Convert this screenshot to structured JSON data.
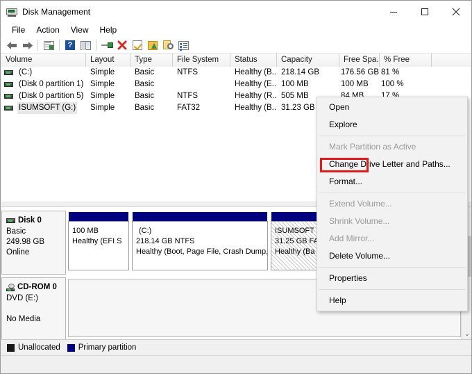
{
  "window": {
    "title": "Disk Management",
    "icon": "disk-management-icon",
    "controls": {
      "minimize": "–",
      "maximize": "□",
      "close": "✕"
    }
  },
  "menubar": {
    "items": [
      "File",
      "Action",
      "View",
      "Help"
    ]
  },
  "toolbar": {
    "buttons": [
      {
        "name": "back-arrow-icon",
        "glyph": "←"
      },
      {
        "name": "forward-arrow-icon",
        "glyph": "→"
      },
      {
        "name": "show-hide-console-tree-icon",
        "glyph": ""
      },
      {
        "name": "help-icon",
        "glyph": "?"
      },
      {
        "name": "action-menu-icon",
        "glyph": ""
      },
      {
        "name": "rescan-disks-icon",
        "glyph": ""
      },
      {
        "name": "delete-icon",
        "glyph": "✖"
      },
      {
        "name": "check-icon",
        "glyph": ""
      },
      {
        "name": "new-volume-icon",
        "glyph": ""
      },
      {
        "name": "properties-search-icon",
        "glyph": ""
      },
      {
        "name": "properties-icon",
        "glyph": ""
      }
    ]
  },
  "volume_list": {
    "columns": [
      "Volume",
      "Layout",
      "Type",
      "File System",
      "Status",
      "Capacity",
      "Free Spa...",
      "% Free",
      ""
    ],
    "rows": [
      {
        "volume": "(C:)",
        "layout": "Simple",
        "type": "Basic",
        "file_system": "NTFS",
        "status": "Healthy (B...",
        "capacity": "218.14 GB",
        "free_space": "176.56 GB",
        "percent_free": "81 %",
        "selected": false
      },
      {
        "volume": "(Disk 0 partition 1)",
        "layout": "Simple",
        "type": "Basic",
        "file_system": "",
        "status": "Healthy (E...",
        "capacity": "100 MB",
        "free_space": "100 MB",
        "percent_free": "100 %",
        "selected": false
      },
      {
        "volume": "(Disk 0 partition 5)",
        "layout": "Simple",
        "type": "Basic",
        "file_system": "NTFS",
        "status": "Healthy (R...",
        "capacity": "505 MB",
        "free_space": "84 MB",
        "percent_free": "17 %",
        "selected": false
      },
      {
        "volume": "ISUMSOFT (G:)",
        "layout": "Simple",
        "type": "Basic",
        "file_system": "FAT32",
        "status": "Healthy (B...",
        "capacity": "31.23 GB",
        "free_space": "",
        "percent_free": "",
        "selected": true
      }
    ]
  },
  "disk_pane": {
    "disks": [
      {
        "name": "Disk 0",
        "type": "Basic",
        "size": "249.98 GB",
        "state": "Online",
        "icon": "disk-icon",
        "partitions": [
          {
            "label": "",
            "size": "100 MB",
            "status": "Healthy (EFI S",
            "selected": false
          },
          {
            "label": "(C:)",
            "size": "218.14 GB NTFS",
            "status": "Healthy (Boot, Page File, Crash Dump, Ba",
            "selected": false
          },
          {
            "label": "ISUMSOFT",
            "size": "31.25 GB FA",
            "status": "Healthy (Ba",
            "selected": true
          }
        ]
      },
      {
        "name": "CD-ROM 0",
        "type": "DVD (E:)",
        "size": "",
        "state": "No Media",
        "icon": "cd-rom-icon",
        "partitions": []
      }
    ]
  },
  "legend": {
    "items": [
      {
        "label": "Unallocated",
        "color": "#1a1a1a"
      },
      {
        "label": "Primary partition",
        "color": "#000080"
      }
    ]
  },
  "context_menu": {
    "items": [
      {
        "label": "Open",
        "disabled": false,
        "separator_after": false
      },
      {
        "label": "Explore",
        "disabled": false,
        "separator_after": true
      },
      {
        "label": "Mark Partition as Active",
        "disabled": true,
        "separator_after": false
      },
      {
        "label": "Change Drive Letter and Paths...",
        "disabled": false,
        "separator_after": false
      },
      {
        "label": "Format...",
        "disabled": false,
        "separator_after": true,
        "highlighted": true
      },
      {
        "label": "Extend Volume...",
        "disabled": true,
        "separator_after": false
      },
      {
        "label": "Shrink Volume...",
        "disabled": true,
        "separator_after": false
      },
      {
        "label": "Add Mirror...",
        "disabled": true,
        "separator_after": false
      },
      {
        "label": "Delete Volume...",
        "disabled": false,
        "separator_after": true
      },
      {
        "label": "Properties",
        "disabled": false,
        "separator_after": true
      },
      {
        "label": "Help",
        "disabled": false,
        "separator_after": false
      }
    ],
    "highlight_color": "#e01b1b"
  },
  "scrollbar": {
    "down_chevron": "⌄"
  }
}
